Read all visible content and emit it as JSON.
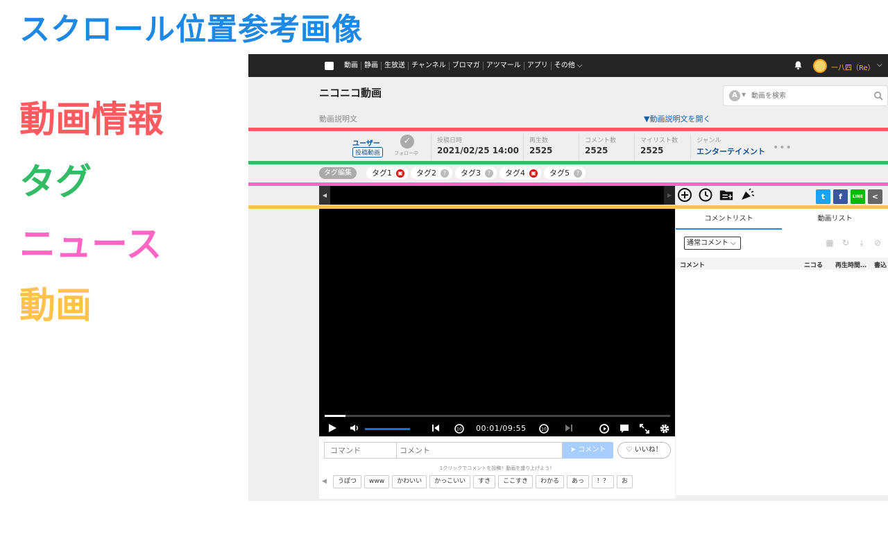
{
  "page": {
    "title": "スクロール位置参考画像",
    "legend": [
      "動画情報",
      "タグ",
      "ニュース",
      "動画"
    ],
    "colors": {
      "title": "#1e88e5",
      "info": "#ff5a5f",
      "tag": "#33bb66",
      "news": "#ff66c4",
      "video": "#ffc34d"
    }
  },
  "topbar": {
    "nav": [
      "動画",
      "静画",
      "生放送",
      "チャンネル",
      "ブロマガ",
      "アツマール",
      "アプリ",
      "その他 ⌵"
    ],
    "username": "一八四（Re）",
    "icons": [
      "niconico-logo-icon",
      "bell-icon",
      "avatar",
      "chevron-down-icon"
    ]
  },
  "header": {
    "site_title": "ニコニコ動画",
    "search_placeholder": "動画を検索",
    "search_a": "A",
    "desc_label": "動画説明文",
    "desc_toggle": "▼動画説明文を開く"
  },
  "info": {
    "user": "ユーザー",
    "badge": "投稿動画",
    "follow": "フォロー中",
    "stats": [
      {
        "key": "投稿日時",
        "value": "2021/02/25 14:00"
      },
      {
        "key": "再生数",
        "value": "2525"
      },
      {
        "key": "コメント数",
        "value": "2525"
      },
      {
        "key": "マイリスト数",
        "value": "2525"
      },
      {
        "key": "ジャンル",
        "value": "エンターテイメント"
      }
    ],
    "more": "•••"
  },
  "tags": {
    "edit": "タグ編集",
    "items": [
      {
        "label": "タグ1",
        "icon": "lock-icon",
        "color": "red"
      },
      {
        "label": "タグ2",
        "icon": "help-icon",
        "color": "gray"
      },
      {
        "label": "タグ3",
        "icon": "help-icon",
        "color": "gray"
      },
      {
        "label": "タグ4",
        "icon": "lock-icon",
        "color": "red"
      },
      {
        "label": "タグ5",
        "icon": "help-icon",
        "color": "gray"
      }
    ]
  },
  "player": {
    "time": "00:01/09:55",
    "progress": 0.06,
    "volume": 1.0
  },
  "comment": {
    "command_placeholder": "コマンド",
    "comment_placeholder": "コメント",
    "submit": "➤ コメント",
    "like": "♡ いいね！",
    "hint": "1クリックでコメントを投稿！動画を盛り上げよう！",
    "quick": [
      "うぽつ",
      "www",
      "かわいい",
      "かっこいい",
      "すき",
      "ここすき",
      "わかる",
      "あっ",
      "！？",
      "お"
    ]
  },
  "panel": {
    "tabs": [
      "コメントリスト",
      "動画リスト"
    ],
    "filter": "通常コメント ⌵",
    "columns": [
      "コメント",
      "ニコる",
      "再生時間…",
      "書込"
    ],
    "share_labels": [
      "t",
      "f",
      "LINE",
      "<"
    ]
  }
}
